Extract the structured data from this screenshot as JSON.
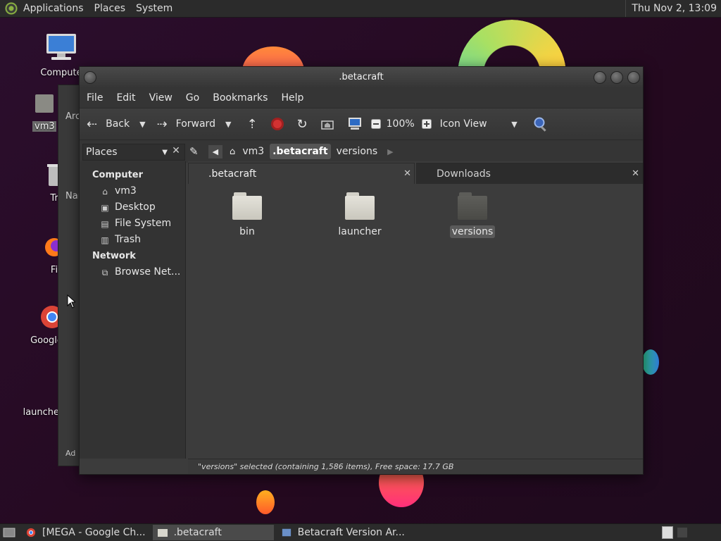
{
  "top_panel": {
    "menus": [
      "Applications",
      "Places",
      "System"
    ],
    "clock": "Thu Nov  2, 13:09"
  },
  "desktop": {
    "icons": [
      {
        "label": "Compute"
      },
      {
        "label": "vm3"
      },
      {
        "label": "Tr"
      },
      {
        "label": "Fi"
      },
      {
        "label": "Google"
      },
      {
        "label": "launcher"
      }
    ]
  },
  "background_window": {
    "title_fragment": "Arc",
    "list_header": "Nar",
    "footer": "Ad"
  },
  "window": {
    "title": ".betacraft",
    "menu": [
      "File",
      "Edit",
      "View",
      "Go",
      "Bookmarks",
      "Help"
    ],
    "toolbar": {
      "back": "Back",
      "forward": "Forward",
      "zoom": "100%",
      "view_mode": "Icon View"
    },
    "sidebar_combo": "Places",
    "breadcrumbs": [
      "vm3",
      ".betacraft",
      "versions"
    ],
    "active_crumb": ".betacraft",
    "sidebar": {
      "sections": [
        {
          "heading": "Computer",
          "items": [
            "vm3",
            "Desktop",
            "File System",
            "Trash"
          ]
        },
        {
          "heading": "Network",
          "items": [
            "Browse Net..."
          ]
        }
      ]
    },
    "tabs": [
      {
        "label": ".betacraft",
        "active": true
      },
      {
        "label": "Downloads",
        "active": false
      }
    ],
    "files": [
      {
        "name": "bin",
        "selected": false
      },
      {
        "name": "launcher",
        "selected": false
      },
      {
        "name": "versions",
        "selected": true
      }
    ],
    "status": "\"versions\" selected (containing 1,586 items), Free space: 17.7 GB"
  },
  "bottom_panel": {
    "tasks": [
      {
        "label": "[MEGA - Google Ch...",
        "icon": "chrome-icon",
        "active": false
      },
      {
        "label": ".betacraft",
        "icon": "folder-icon",
        "active": true
      },
      {
        "label": "Betacraft Version Ar...",
        "icon": "app-icon",
        "active": false
      }
    ]
  }
}
